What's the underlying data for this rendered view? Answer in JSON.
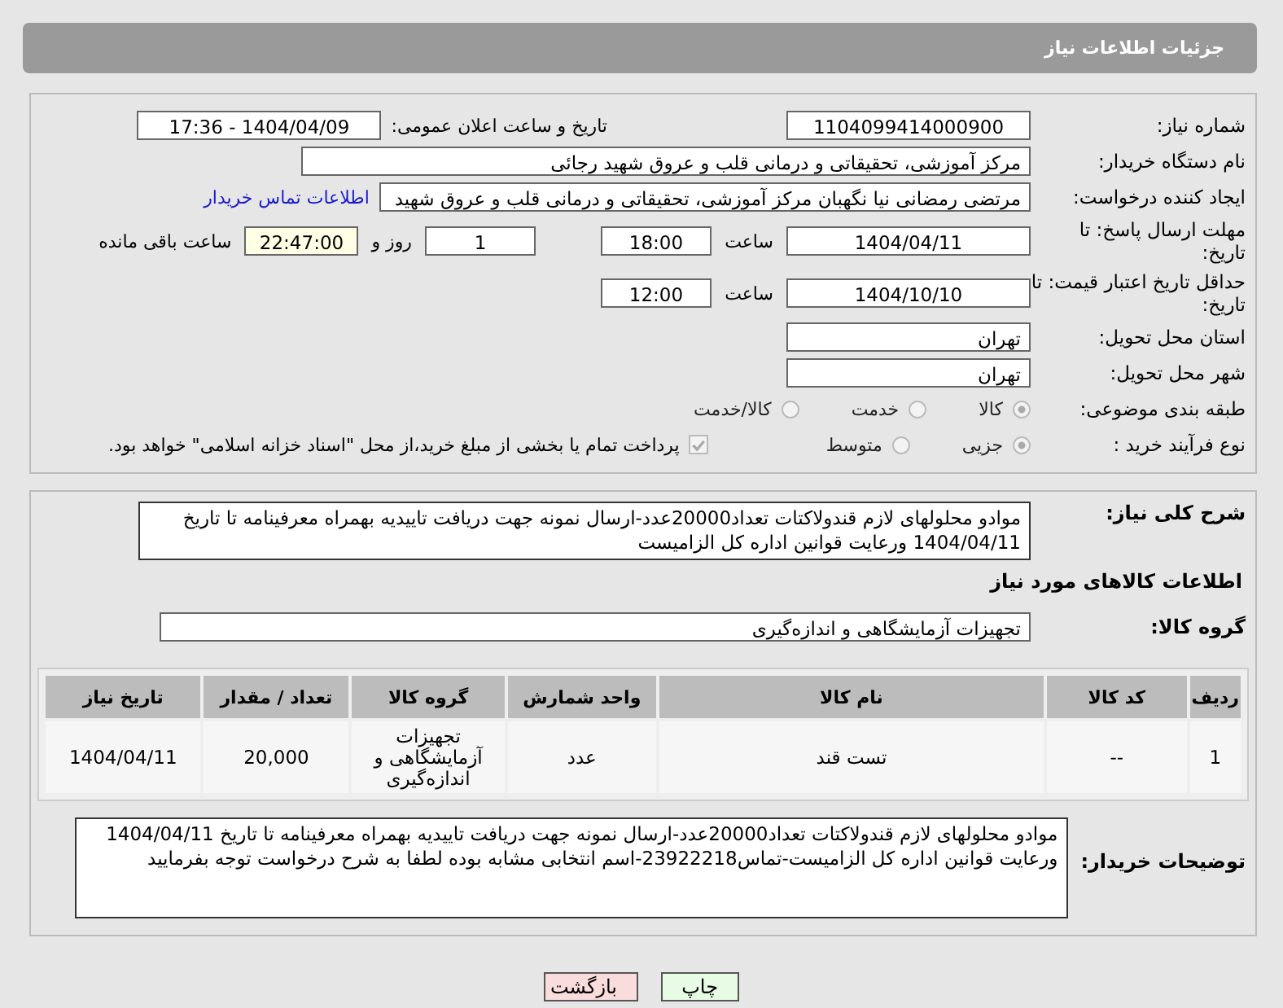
{
  "header": {
    "title": "جزئیات اطلاعات نیاز"
  },
  "need_number": {
    "label": "شماره نیاز:",
    "value": "1104099414000900"
  },
  "announce": {
    "label": "تاریخ و ساعت اعلان عمومی:",
    "value": "1404/04/09 - 17:36"
  },
  "buyer_org": {
    "label": "نام دستگاه خریدار:",
    "value": "مرکز آموزشی، تحقیقاتی و درمانی قلب و عروق شهید رجائی"
  },
  "requester": {
    "label": "ایجاد کننده درخواست:",
    "value": "مرتضی رمضانی نیا نگهبان مرکز آموزشی، تحقیقاتی و درمانی قلب و عروق شهید",
    "link": "اطلاعات تماس خریدار"
  },
  "reply_deadline": {
    "label": "مهلت ارسال پاسخ: تا تاریخ:",
    "date": "1404/04/11",
    "time_label": "ساعت",
    "time": "18:00",
    "days": "1",
    "days_label": "روز و",
    "remaining": "22:47:00",
    "remaining_label": "ساعت باقی مانده"
  },
  "price_validity": {
    "label": "حداقل تاریخ اعتبار قیمت: تا تاریخ:",
    "date": "1404/10/10",
    "time_label": "ساعت",
    "time": "12:00"
  },
  "province": {
    "label": "استان محل تحویل:",
    "value": "تهران"
  },
  "city": {
    "label": "شهر محل تحویل:",
    "value": "تهران"
  },
  "category": {
    "label": "طبقه بندی موضوعی:",
    "options": [
      {
        "label": "کالا",
        "selected": true
      },
      {
        "label": "خدمت",
        "selected": false
      },
      {
        "label": "کالا/خدمت",
        "selected": false
      }
    ]
  },
  "process": {
    "label": "نوع فرآیند خرید :",
    "options": [
      {
        "label": "جزیی",
        "selected": true
      },
      {
        "label": "متوسط",
        "selected": false
      }
    ],
    "payment": {
      "label": "پرداخت تمام یا بخشی از مبلغ خرید،از محل \"اسناد خزانه اسلامی\" خواهد بود.",
      "checked": true
    }
  },
  "summary": {
    "label": "شرح کلی نیاز:",
    "value": "موادو محلولهای لازم قندولاکتات تعداد20000عدد-ارسال نمونه جهت دریافت تاییدیه بهمراه معرفینامه تا تاریخ 1404/04/11 ورعایت قوانین اداره کل الزامیست"
  },
  "goods_title": "اطلاعات کالاهای مورد نیاز",
  "goods_group": {
    "label": "گروه کالا:",
    "value": "تجهیزات آزمایشگاهی و اندازه‌گیری"
  },
  "table": {
    "columns": [
      "ردیف",
      "کد کالا",
      "نام کالا",
      "واحد شمارش",
      "گروه کالا",
      "تعداد / مقدار",
      "تاریخ نیاز"
    ],
    "rows": [
      [
        "1",
        "--",
        "تست قند",
        "عدد",
        "تجهیزات آزمایشگاهی و اندازه‌گیری",
        "20,000",
        "1404/04/11"
      ]
    ]
  },
  "buyer_notes": {
    "label": "توضیحات خریدار:",
    "value": "موادو محلولهای لازم قندولاکتات تعداد20000عدد-ارسال نمونه جهت دریافت تاییدیه بهمراه معرفینامه تا تاریخ 1404/04/11 ورعایت قوانین اداره کل الزامیست-تماس23922218-اسم انتخابی مشابه بوده لطفا به شرح درخواست توجه بفرمایید"
  },
  "buttons": [
    {
      "label": "چاپ",
      "kind": "print"
    },
    {
      "label": "بازگشت",
      "kind": "back"
    }
  ]
}
